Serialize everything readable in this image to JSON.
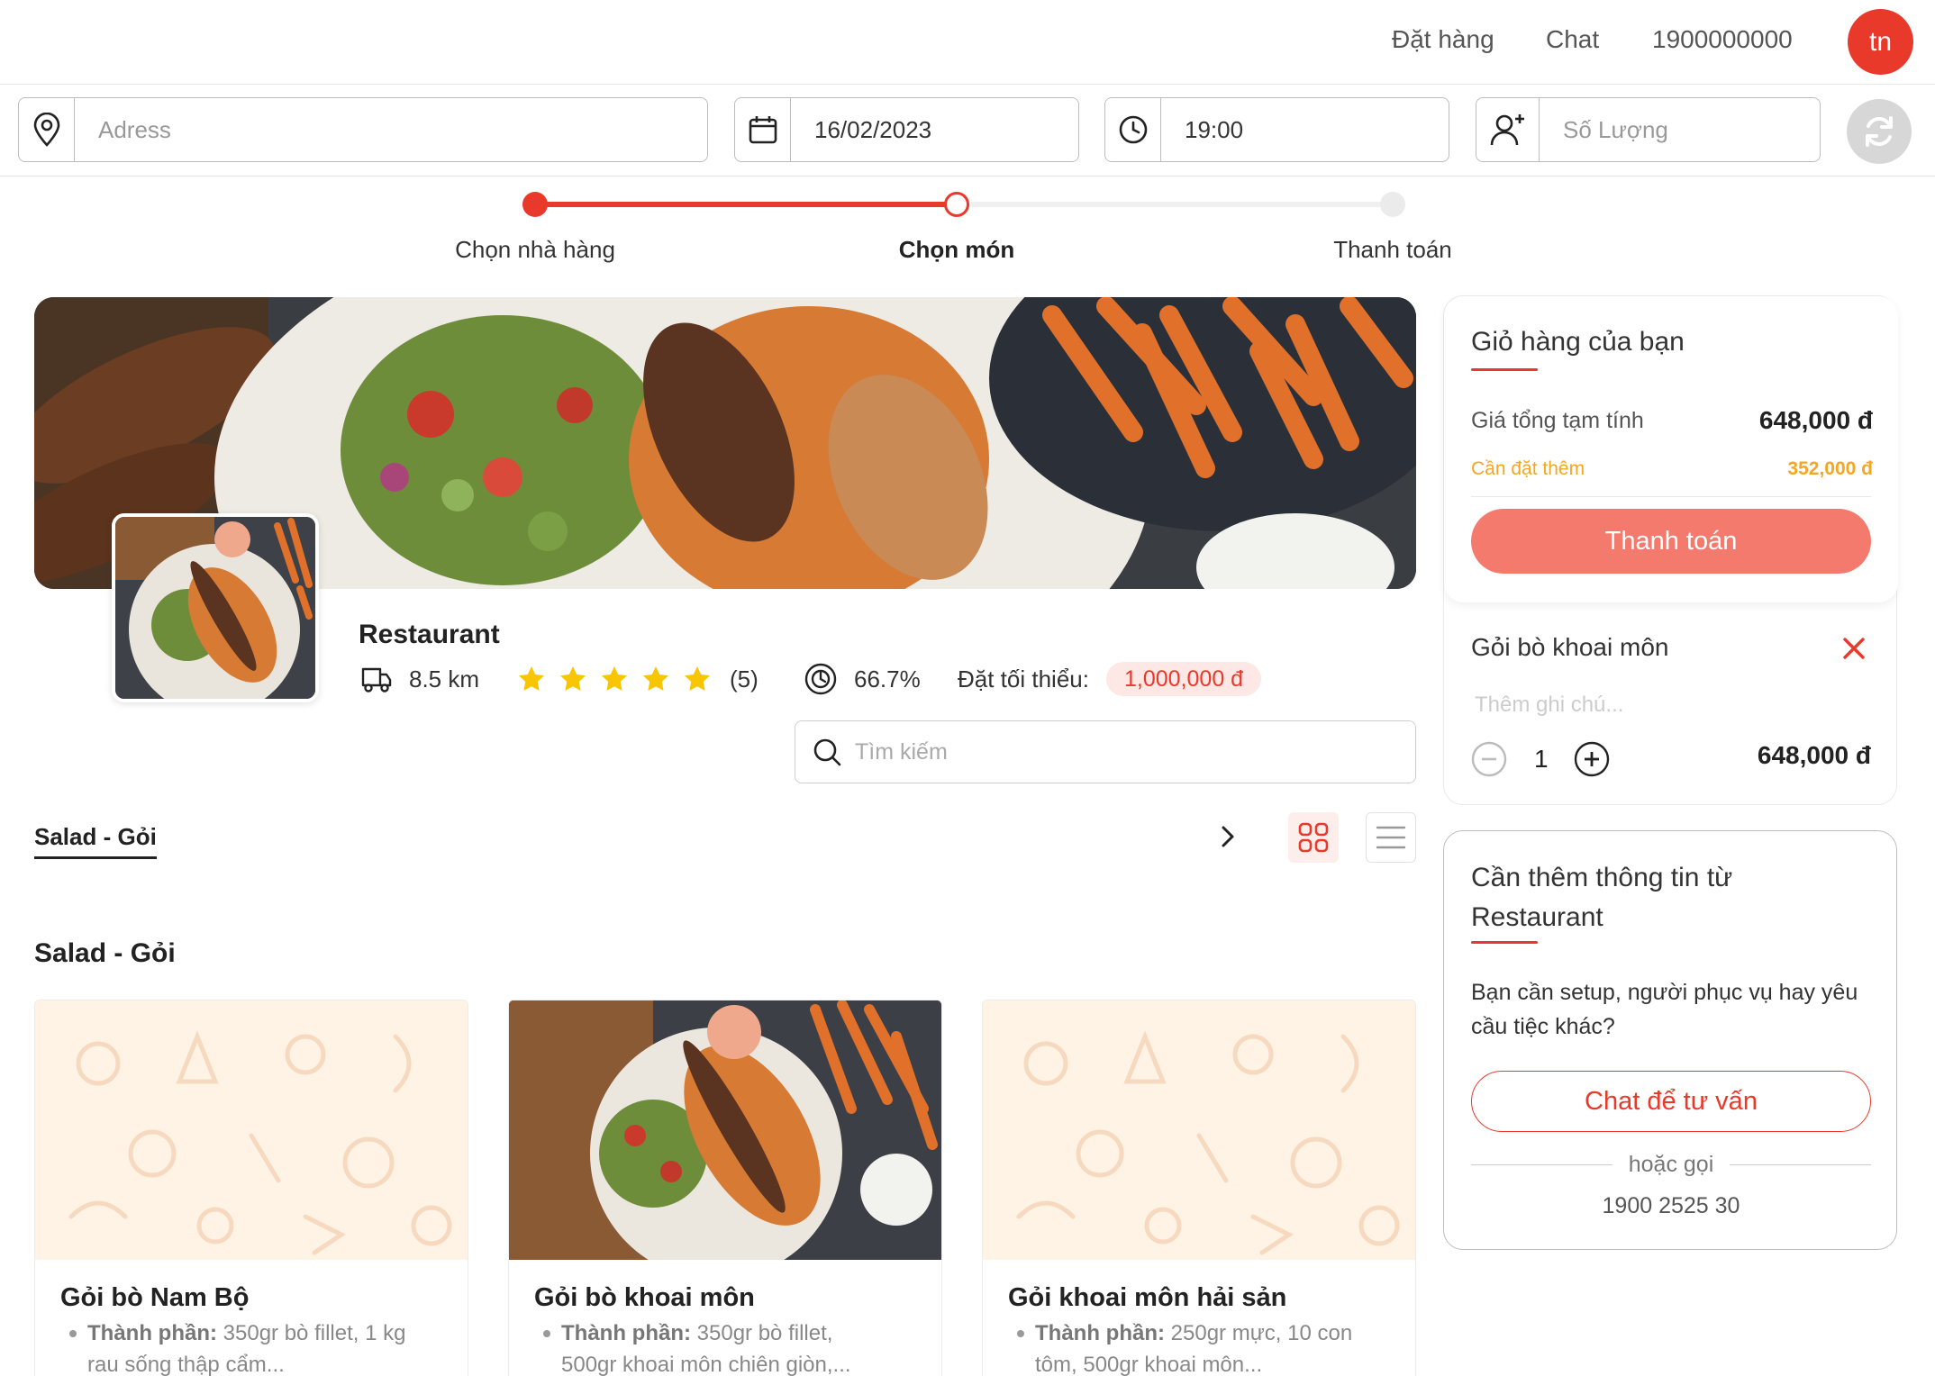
{
  "nav": {
    "order": "Đặt hàng",
    "chat": "Chat",
    "hotline": "1900000000",
    "avatar_initials": "tn"
  },
  "filters": {
    "address_placeholder": "Adress",
    "date": "16/02/2023",
    "time": "19:00",
    "quantity_placeholder": "Số Lượng"
  },
  "stepper": {
    "steps": [
      "Chọn nhà hàng",
      "Chọn món",
      "Thanh toán"
    ],
    "active_index": 1
  },
  "restaurant": {
    "name": "Restaurant",
    "distance": "8.5 km",
    "rating_stars": 5,
    "rating_count": "(5)",
    "percent": "66.7%",
    "min_order_label": "Đặt tối thiểu:",
    "min_order_value": "1,000,000 đ"
  },
  "search": {
    "placeholder": "Tìm kiếm"
  },
  "category_tab": "Salad - Gỏi",
  "section_title": "Salad - Gỏi",
  "dishes": [
    {
      "name": "Gỏi bò Nam Bộ",
      "ing_label": "Thành phần:",
      "ing_text": "350gr bò fillet, 1 kg rau sống thập cẩm...",
      "has_photo": false
    },
    {
      "name": "Gỏi bò khoai môn",
      "ing_label": "Thành phần:",
      "ing_text": "350gr bò fillet, 500gr khoai môn chiên giòn,...",
      "has_photo": true
    },
    {
      "name": "Gỏi khoai môn hải sản",
      "ing_label": "Thành phần:",
      "ing_text": "250gr mực, 10 con tôm, 500gr khoai môn...",
      "has_photo": false
    }
  ],
  "cart": {
    "title": "Giỏ hàng của bạn",
    "subtotal_label": "Giá tổng tạm tính",
    "subtotal_value": "648,000 đ",
    "need_more_label": "Cần đặt thêm",
    "need_more_value": "352,000 đ",
    "pay_button": "Thanh toán",
    "item": {
      "name": "Gỏi bò khoai môn",
      "note_placeholder": "Thêm ghi chú...",
      "qty": "1",
      "price": "648,000 đ"
    }
  },
  "consult": {
    "heading": "Cần thêm thông tin từ Restaurant",
    "question": "Bạn cần setup, người phục vụ hay yêu cầu tiệc khác?",
    "chat_button": "Chat để tư vấn",
    "or_text": "hoặc gọi",
    "phone": "1900 2525 30"
  },
  "colors": {
    "accent": "#e8392b",
    "accent_light": "#f47a6e",
    "warning": "#f5a623",
    "star": "#f7c600"
  }
}
